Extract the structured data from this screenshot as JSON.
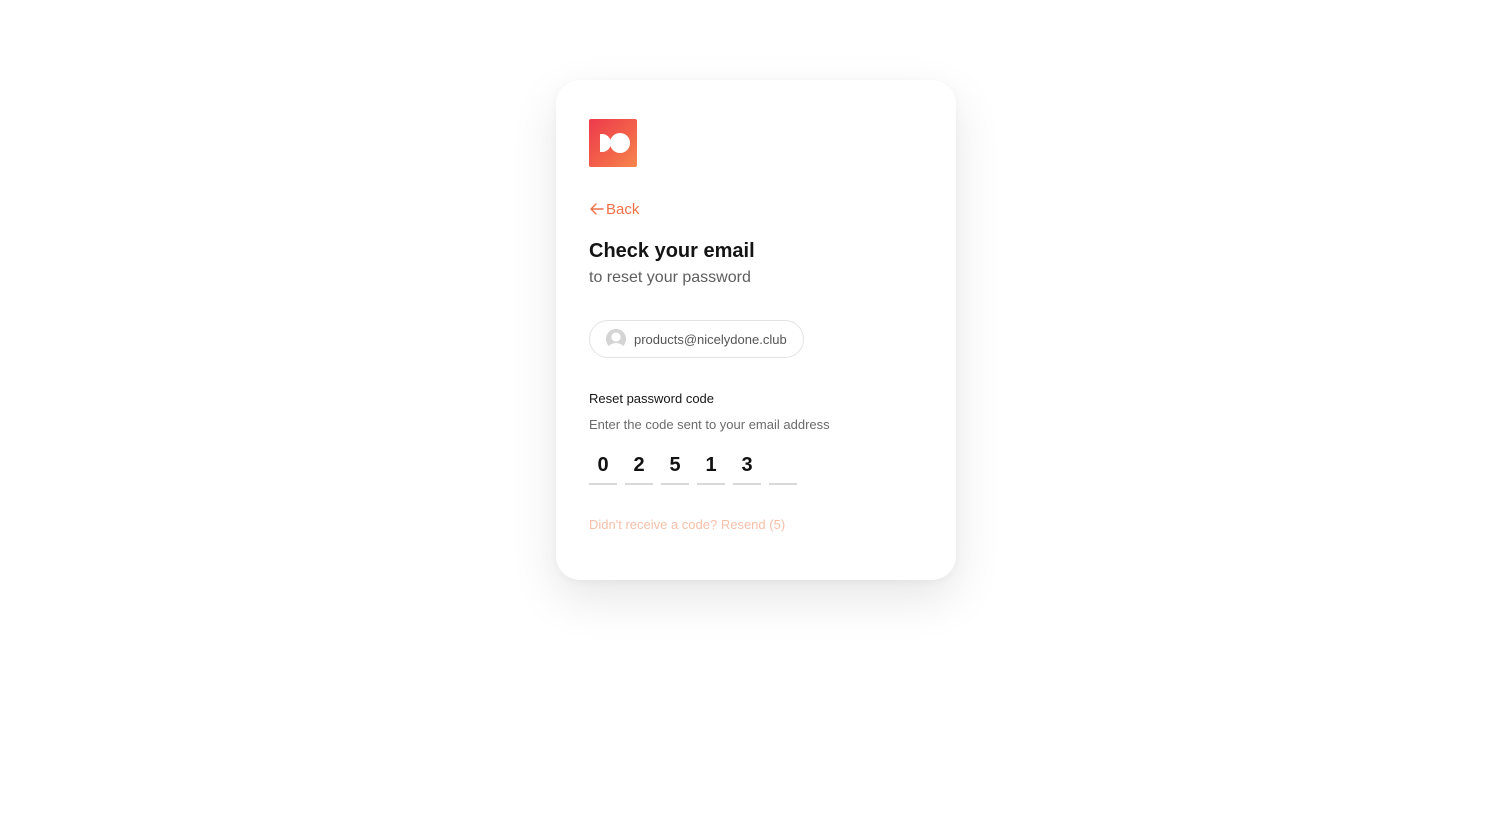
{
  "brand": {
    "logo_name": "brand-logo",
    "gradient_start": "#ee3a4c",
    "gradient_end": "#f7874d"
  },
  "nav": {
    "back_label": "Back",
    "back_icon": "arrow-left-icon",
    "accent_color": "#f07149"
  },
  "header": {
    "title": "Check your email",
    "subtitle": "to reset your password"
  },
  "identity": {
    "email": "products@nicelydone.club",
    "avatar_icon": "user-avatar-icon"
  },
  "reset_code": {
    "label": "Reset password code",
    "hint": "Enter the code sent to your email address",
    "digits": [
      "0",
      "2",
      "5",
      "1",
      "3",
      ""
    ]
  },
  "resend": {
    "text": "Didn't receive a code? Resend (5)",
    "color": "#f6bfa9"
  }
}
